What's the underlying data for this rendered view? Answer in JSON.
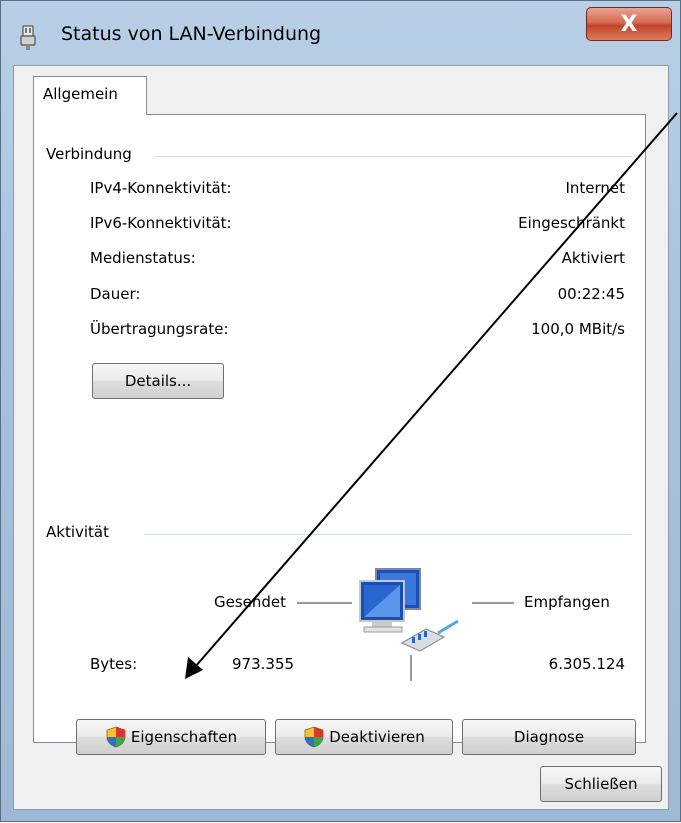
{
  "window": {
    "title": "Status von LAN-Verbindung",
    "close_label": "X"
  },
  "tabs": [
    {
      "label": "Allgemein",
      "active": true
    }
  ],
  "connection": {
    "group_label": "Verbindung",
    "rows": [
      {
        "label": "IPv4-Konnektivität:",
        "value": "Internet"
      },
      {
        "label": "IPv6-Konnektivität:",
        "value": "Eingeschränkt"
      },
      {
        "label": "Medienstatus:",
        "value": "Aktiviert"
      },
      {
        "label": "Dauer:",
        "value": "00:22:45"
      },
      {
        "label": "Übertragungsrate:",
        "value": "100,0 MBit/s"
      }
    ],
    "details_button": "Details..."
  },
  "activity": {
    "group_label": "Aktivität",
    "sent_label": "Gesendet",
    "received_label": "Empfangen",
    "bytes_label": "Bytes:",
    "bytes_sent": "973.355",
    "bytes_received": "6.305.124"
  },
  "buttons": {
    "properties": "Eigenschaften",
    "deactivate": "Deaktivieren",
    "diagnose": "Diagnose",
    "close": "Schließen"
  },
  "colors": {
    "shield_blue": "#2f6fd0",
    "shield_red": "#d8372b",
    "shield_yellow": "#f2c233",
    "shield_green": "#3aa64a"
  }
}
